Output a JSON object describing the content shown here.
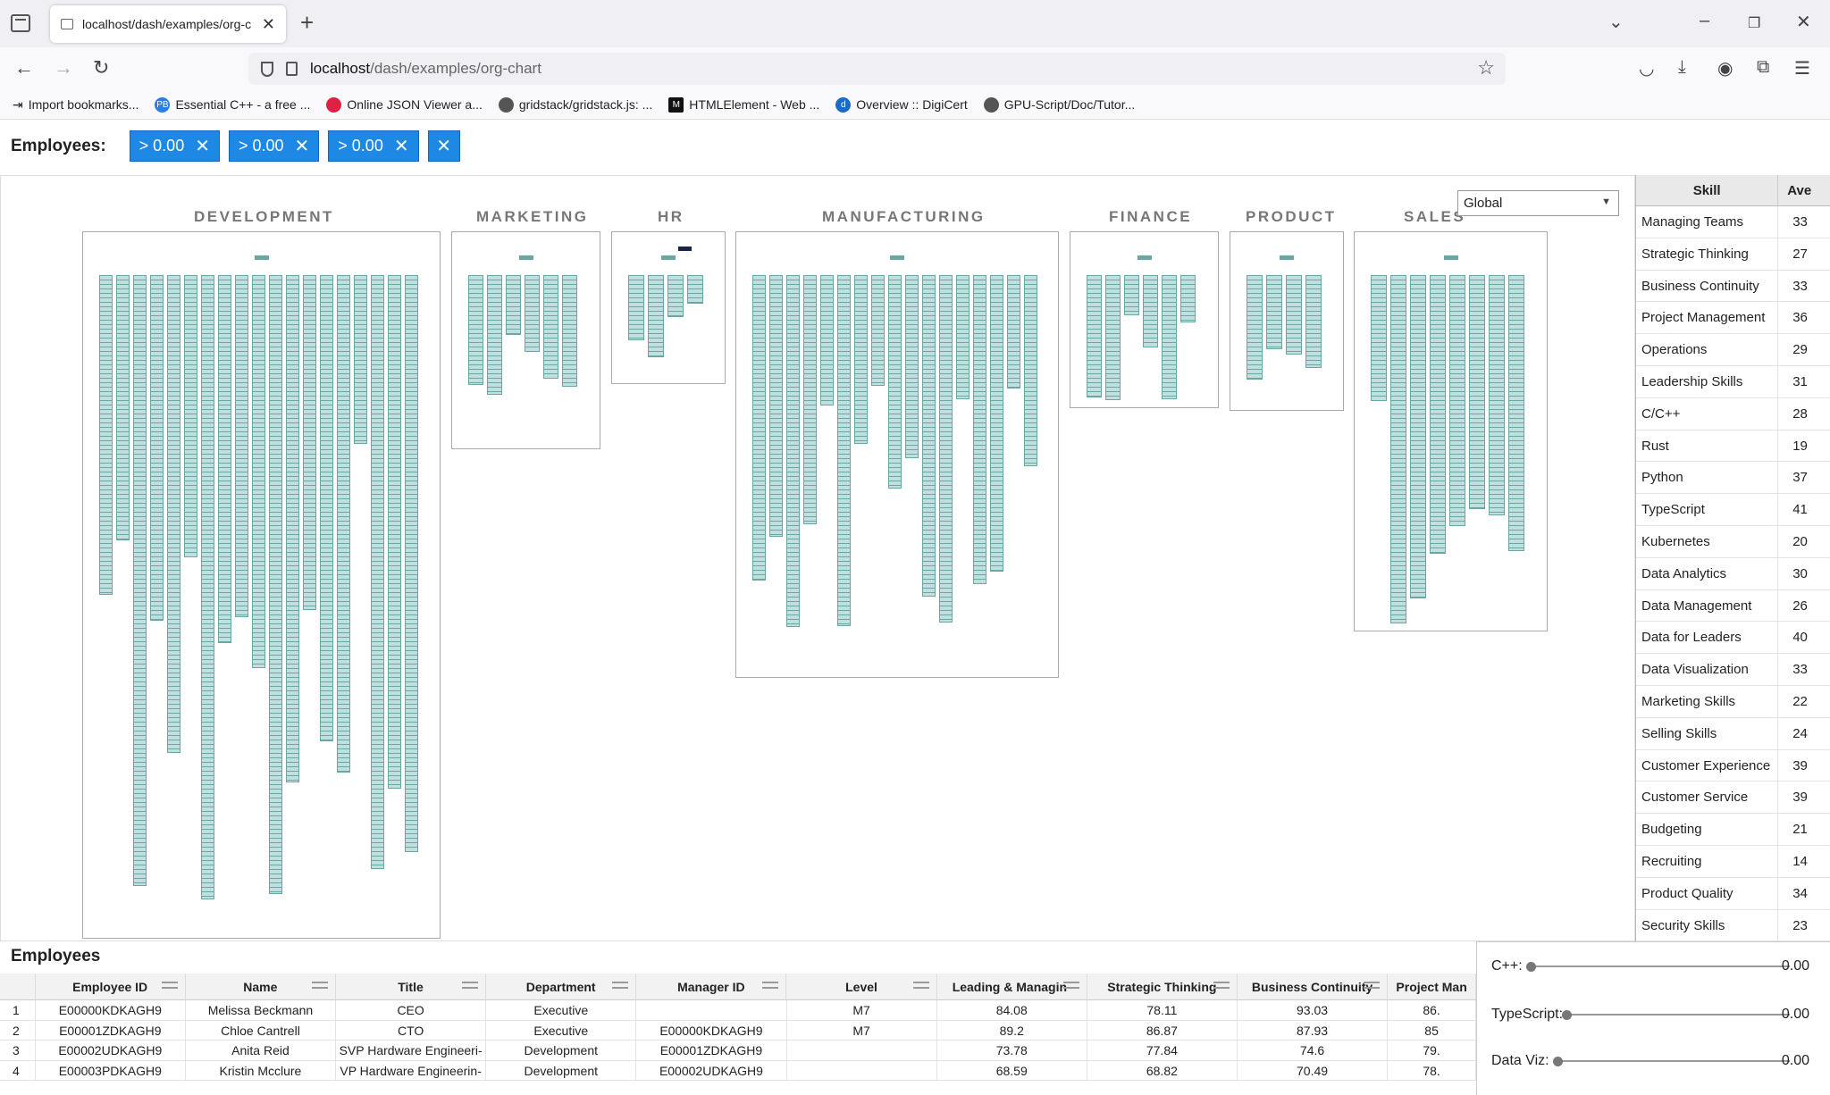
{
  "browser": {
    "tab_title": "localhost/dash/examples/org-c",
    "url_host": "localhost",
    "url_path": "/dash/examples/org-chart",
    "bookmarks": [
      {
        "label": "Import bookmarks...",
        "icon": "import-icon"
      },
      {
        "label": "Essential C++ - a free ...",
        "icon": "pb-icon"
      },
      {
        "label": "Online JSON Viewer a...",
        "icon": "json-icon"
      },
      {
        "label": "gridstack/gridstack.js: ...",
        "icon": "github-icon"
      },
      {
        "label": "HTMLElement - Web ...",
        "icon": "mdn-icon"
      },
      {
        "label": "Overview :: DigiCert",
        "icon": "digicert-icon"
      },
      {
        "label": "GPU-Script/Doc/Tutor...",
        "icon": "github-icon"
      }
    ]
  },
  "filters": {
    "label": "Employees:",
    "chips": [
      "> 0.00",
      "> 0.00",
      "> 0.00"
    ]
  },
  "departments": [
    "DEVELOPMENT",
    "MARKETING",
    "HR",
    "MANUFACTURING",
    "FINANCE",
    "PRODUCT",
    "SALES"
  ],
  "scope_select": {
    "value": "Global"
  },
  "skills": {
    "header": {
      "skill": "Skill",
      "avg": "Ave"
    },
    "rows": [
      {
        "name": "Managing Teams",
        "avg": "33"
      },
      {
        "name": "Strategic Thinking",
        "avg": "27"
      },
      {
        "name": "Business Continuity",
        "avg": "33"
      },
      {
        "name": "Project Management",
        "avg": "36"
      },
      {
        "name": "Operations",
        "avg": "29"
      },
      {
        "name": "Leadership Skills",
        "avg": "31"
      },
      {
        "name": "C/C++",
        "avg": "28"
      },
      {
        "name": "Rust",
        "avg": "19"
      },
      {
        "name": "Python",
        "avg": "37"
      },
      {
        "name": "TypeScript",
        "avg": "41"
      },
      {
        "name": "Kubernetes",
        "avg": "20"
      },
      {
        "name": "Data Analytics",
        "avg": "30"
      },
      {
        "name": "Data Management",
        "avg": "26"
      },
      {
        "name": "Data for Leaders",
        "avg": "40"
      },
      {
        "name": "Data Visualization",
        "avg": "33"
      },
      {
        "name": "Marketing Skills",
        "avg": "22"
      },
      {
        "name": "Selling Skills",
        "avg": "24"
      },
      {
        "name": "Customer Experience",
        "avg": "39"
      },
      {
        "name": "Customer Service",
        "avg": "39"
      },
      {
        "name": "Budgeting",
        "avg": "21"
      },
      {
        "name": "Recruiting",
        "avg": "14"
      },
      {
        "name": "Product Quality",
        "avg": "34"
      },
      {
        "name": "Security Skills",
        "avg": "23"
      }
    ]
  },
  "employees": {
    "title": "Employees",
    "columns": [
      "Employee ID",
      "Name",
      "Title",
      "Department",
      "Manager ID",
      "Level",
      "Leading & Managin-",
      "Strategic Thinking",
      "Business Continuity",
      "Project Man"
    ],
    "rows": [
      [
        "1",
        "E00000KDKAGH9",
        "Melissa Beckmann",
        "CEO",
        "Executive",
        "",
        "M7",
        "84.08",
        "78.11",
        "93.03",
        "86."
      ],
      [
        "2",
        "E00001ZDKAGH9",
        "Chloe Cantrell",
        "CTO",
        "Executive",
        "E00000KDKAGH9",
        "M7",
        "89.2",
        "86.87",
        "87.93",
        "85"
      ],
      [
        "3",
        "E00002UDKAGH9",
        "Anita Reid",
        "SVP Hardware Engineeri-",
        "Development",
        "E00001ZDKAGH9",
        "",
        "73.78",
        "77.84",
        "74.6",
        "79."
      ],
      [
        "4",
        "E00003PDKAGH9",
        "Kristin Mcclure",
        "VP Hardware Engineerin-",
        "Development",
        "E00002UDKAGH9",
        "",
        "68.59",
        "68.82",
        "70.49",
        "78."
      ]
    ]
  },
  "sliders": [
    {
      "label": "C++:",
      "value": "0.00",
      "level": 0
    },
    {
      "label": "TypeScript:",
      "value": "0.00",
      "level": 0
    },
    {
      "label": "Data Viz:",
      "value": "0.00",
      "level": 0
    }
  ]
}
